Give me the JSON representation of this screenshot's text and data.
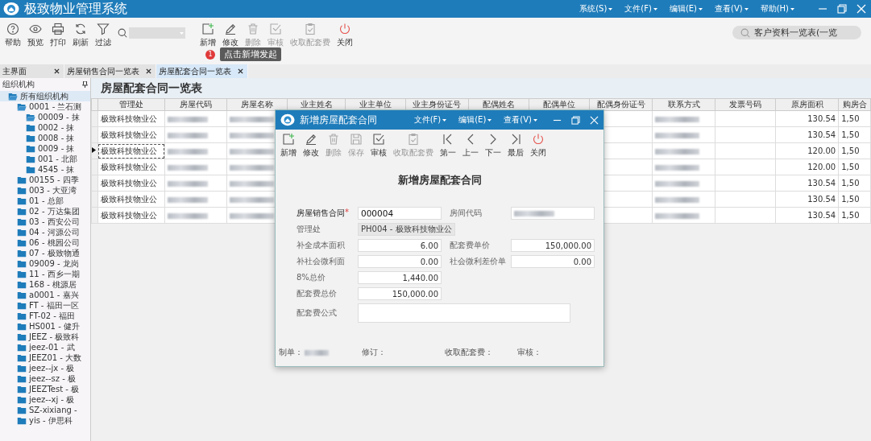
{
  "window": {
    "title": "极致物业管理系统",
    "menus": [
      "系统(S)",
      "文件(F)",
      "编辑(E)",
      "查看(V)",
      "帮助(H)"
    ]
  },
  "toolbar": {
    "left_buttons": [
      {
        "label": "帮助",
        "disabled": false
      },
      {
        "label": "预览",
        "disabled": false
      },
      {
        "label": "打印",
        "disabled": false
      },
      {
        "label": "刷新",
        "disabled": false
      },
      {
        "label": "过滤",
        "disabled": false
      }
    ],
    "right_buttons": [
      {
        "label": "新增",
        "disabled": false
      },
      {
        "label": "修改",
        "disabled": false
      },
      {
        "label": "删除",
        "disabled": true
      },
      {
        "label": "审核",
        "disabled": true
      },
      {
        "label": "收取配套费",
        "disabled": true
      },
      {
        "label": "关闭",
        "disabled": false
      }
    ],
    "global_search": {
      "value": "客户资料一览表(一览"
    },
    "tooltip": {
      "badge": "1",
      "text": "点击新增发起"
    }
  },
  "tabs": [
    {
      "label": "主界面",
      "selected": false
    },
    {
      "label": "房屋销售合同一览表",
      "selected": false
    },
    {
      "label": "房屋配套合同一览表",
      "selected": true
    }
  ],
  "sidebar": {
    "title": "组织机构",
    "tree": [
      {
        "label": "所有组织机构",
        "expanded": true,
        "children": [
          {
            "label": "0001 - 兰石测",
            "expanded": true,
            "children": [
              {
                "label": "00009 - 抹",
                "expanded": true
              },
              {
                "label": "0002 - 抹",
                "expanded": false
              },
              {
                "label": "0008 - 抹",
                "expanded": false
              },
              {
                "label": "0009 - 抹",
                "expanded": false
              },
              {
                "label": "001 - 北部",
                "expanded": false
              },
              {
                "label": "4545 - 抹",
                "expanded": false
              }
            ]
          },
          {
            "label": "00155 - 四季",
            "expanded": false
          },
          {
            "label": "003 - 大亚湾",
            "expanded": false
          },
          {
            "label": "01 - 总部",
            "expanded": false
          },
          {
            "label": "02 - 万达集团",
            "expanded": false
          },
          {
            "label": "03 - 西安公司",
            "expanded": false
          },
          {
            "label": "04 - 河源公司",
            "expanded": false
          },
          {
            "label": "06 - 桃园公司",
            "expanded": false
          },
          {
            "label": "07 - 极致物通",
            "expanded": false
          },
          {
            "label": "09009 - 龙岗",
            "expanded": false
          },
          {
            "label": "11 - 西乡一期",
            "expanded": false
          },
          {
            "label": "168 - 桃源居",
            "expanded": false
          },
          {
            "label": "a0001 - 嘉兴",
            "expanded": false
          },
          {
            "label": "FT - 福田一区",
            "expanded": false
          },
          {
            "label": "FT-02 - 福田",
            "expanded": false
          },
          {
            "label": "HS001 - 健升",
            "expanded": false
          },
          {
            "label": "JEEZ - 极致科",
            "expanded": false
          },
          {
            "label": "jeez-01 - 武",
            "expanded": false
          },
          {
            "label": "JEEZ01 - 大数",
            "expanded": false
          },
          {
            "label": "jeez--jx - 极",
            "expanded": false
          },
          {
            "label": "jeez--sz - 极",
            "expanded": false
          },
          {
            "label": "JEEZTest - 极",
            "expanded": false
          },
          {
            "label": "jeez--xj - 极",
            "expanded": false
          },
          {
            "label": "SZ-xixiang -",
            "expanded": false
          },
          {
            "label": "yis - 伊思科",
            "expanded": false
          }
        ]
      }
    ]
  },
  "page": {
    "title": "房屋配套合同一览表"
  },
  "table": {
    "columns": [
      "管理处",
      "房屋代码",
      "房屋名称",
      "业主姓名",
      "业主单位",
      "业主身份证号",
      "配偶姓名",
      "配偶单位",
      "配偶身份证号",
      "联系方式",
      "发票号码",
      "原房面积",
      "购房合"
    ],
    "rows": [
      {
        "manager": "极致科技物业公",
        "area": "130.54",
        "purchase": "1,50",
        "selected": false
      },
      {
        "manager": "极致科技物业公",
        "area": "130.54",
        "purchase": "1,50",
        "selected": false
      },
      {
        "manager": "极致科技物业公",
        "area": "120.00",
        "purchase": "1,50",
        "selected": true
      },
      {
        "manager": "极致科技物业公",
        "area": "120.00",
        "purchase": "1,50",
        "selected": false
      },
      {
        "manager": "极致科技物业公",
        "area": "130.54",
        "purchase": "1,50",
        "selected": false
      },
      {
        "manager": "极致科技物业公",
        "area": "130.54",
        "purchase": "1,50",
        "selected": false
      },
      {
        "manager": "极致科技物业公",
        "area": "130.54",
        "purchase": "1,50",
        "selected": false
      }
    ]
  },
  "dialog": {
    "title": "新增房屋配套合同",
    "menus": [
      "文件(F)",
      "编辑(E)",
      "查看(V)"
    ],
    "buttons": [
      {
        "label": "新增",
        "disabled": false
      },
      {
        "label": "修改",
        "disabled": false
      },
      {
        "label": "删除",
        "disabled": true
      },
      {
        "label": "保存",
        "disabled": true
      },
      {
        "label": "审核",
        "disabled": false
      },
      {
        "label": "收取配套费",
        "disabled": true
      },
      {
        "label": "第一",
        "disabled": false
      },
      {
        "label": "上一",
        "disabled": false
      },
      {
        "label": "下一",
        "disabled": false
      },
      {
        "label": "最后",
        "disabled": false
      },
      {
        "label": "关闭",
        "disabled": false
      }
    ],
    "form_title": "新增房屋配套合同",
    "rows": [
      [
        {
          "kind": "text",
          "label": "房屋销售合同",
          "required": true,
          "required_mark": "*",
          "readonly": false,
          "value": "000004"
        },
        {
          "kind": "redacted",
          "label": "房间代码",
          "required": false,
          "readonly": false
        }
      ],
      [
        {
          "kind": "text",
          "label": "管理处",
          "required": false,
          "readonly": true,
          "value": "PH004 - 极致科技物业公"
        }
      ],
      [
        {
          "kind": "number",
          "label": "补全成本面积",
          "required": false,
          "readonly": false,
          "value": "6.00"
        },
        {
          "kind": "number",
          "label": "配套费单价",
          "required": false,
          "readonly": false,
          "value": "150,000.00"
        }
      ],
      [
        {
          "kind": "number",
          "label": "补社会微利面",
          "required": false,
          "readonly": false,
          "value": "0.00"
        },
        {
          "kind": "number",
          "label": "社会微利差价单",
          "required": false,
          "readonly": false,
          "value": "0.00"
        }
      ],
      [
        {
          "kind": "number",
          "label": "8%总价",
          "required": false,
          "readonly": false,
          "value": "1,440.00"
        }
      ],
      [
        {
          "kind": "number",
          "label": "配套费总价",
          "required": false,
          "readonly": false,
          "value": "150,000.00"
        }
      ],
      [
        {
          "kind": "textarea",
          "label": "配套费公式",
          "required": false,
          "readonly": false
        }
      ]
    ],
    "footer": [
      {
        "label": "制单：",
        "redacted": true
      },
      {
        "label": "修订：",
        "redacted": false
      },
      {
        "label": "收取配套费：",
        "redacted": false
      },
      {
        "label": "审核：",
        "redacted": false
      }
    ]
  }
}
